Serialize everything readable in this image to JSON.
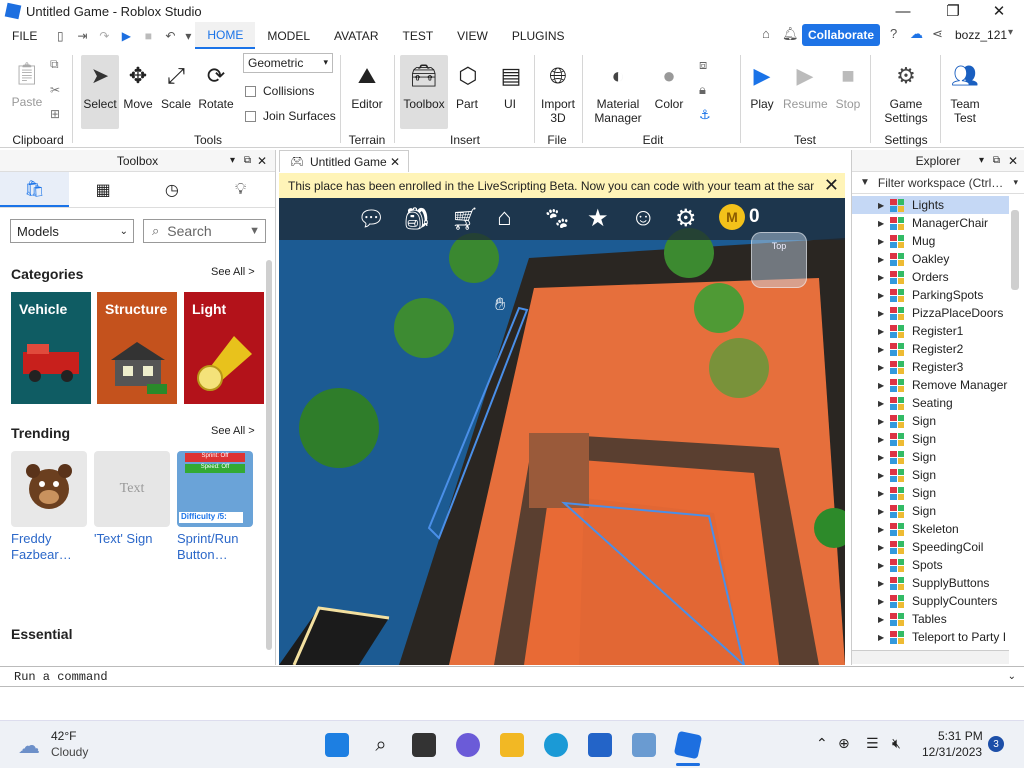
{
  "window": {
    "title": "Untitled Game - Roblox Studio",
    "min": "—",
    "max": "❐",
    "close": "✕"
  },
  "menu": {
    "file": "FILE",
    "tabs": [
      "HOME",
      "MODEL",
      "AVATAR",
      "TEST",
      "VIEW",
      "PLUGINS"
    ],
    "collaborate": "Collaborate",
    "user": "bozz_121"
  },
  "ribbon": {
    "paste": "Paste",
    "select": "Select",
    "move": "Move",
    "scale": "Scale",
    "rotate": "Rotate",
    "transform_mode": "Geometric",
    "collisions": "Collisions",
    "join_surfaces": "Join Surfaces",
    "editor": "Editor",
    "toolbox": "Toolbox",
    "part": "Part",
    "ui": "UI",
    "import3d_1": "Import",
    "import3d_2": "3D",
    "material_1": "Material",
    "material_2": "Manager",
    "color": "Color",
    "play": "Play",
    "resume": "Resume",
    "stop": "Stop",
    "game_settings_1": "Game",
    "game_settings_2": "Settings",
    "team_test_1": "Team",
    "team_test_2": "Test",
    "groups": {
      "clipboard": "Clipboard",
      "tools": "Tools",
      "terrain": "Terrain",
      "insert": "Insert",
      "file": "File",
      "edit": "Edit",
      "test": "Test",
      "settings": "Settings"
    }
  },
  "toolbox": {
    "title": "Toolbox",
    "category_select": "Models",
    "search_placeholder": "Search",
    "categories_title": "Categories",
    "see_all": "See All >",
    "categories": [
      {
        "label": "Vehicle",
        "color": "#0f5c63"
      },
      {
        "label": "Structure",
        "color": "#c4521d"
      },
      {
        "label": "Light",
        "color": "#b3121a"
      }
    ],
    "trending_title": "Trending",
    "trending": [
      {
        "label1": "Freddy",
        "label2": "Fazbear…"
      },
      {
        "label1": "'Text' Sign",
        "label2": ""
      },
      {
        "label1": "Sprint/Run",
        "label2": "Button…"
      }
    ],
    "text_thumb": "Text",
    "sprint_thumb": "Sprint: Off",
    "speed_thumb": "Speed: Off",
    "difficulty_thumb": "Difficulty /5:",
    "essential_title": "Essential"
  },
  "viewport": {
    "tab": "Untitled Game",
    "banner": "This place has been enrolled in the LiveScripting Beta. Now you can code with your team at the same time",
    "coins": "0",
    "cube_label": "Top"
  },
  "explorer": {
    "title": "Explorer",
    "filter_placeholder": "Filter workspace (Ctrl…",
    "items": [
      "Lights",
      "ManagerChair",
      "Mug",
      "Oakley",
      "Orders",
      "ParkingSpots",
      "PizzaPlaceDoors",
      "Register1",
      "Register2",
      "Register3",
      "Remove Manager",
      "Seating",
      "Sign",
      "Sign",
      "Sign",
      "Sign",
      "Sign",
      "Sign",
      "Skeleton",
      "SpeedingCoil",
      "Spots",
      "SupplyButtons",
      "SupplyCounters",
      "Tables",
      "Teleport to Party I"
    ]
  },
  "command": {
    "placeholder": "Run a command"
  },
  "taskbar": {
    "temp": "42°F",
    "weather": "Cloudy",
    "time": "5:31 PM",
    "date": "12/31/2023",
    "notif": "3"
  }
}
